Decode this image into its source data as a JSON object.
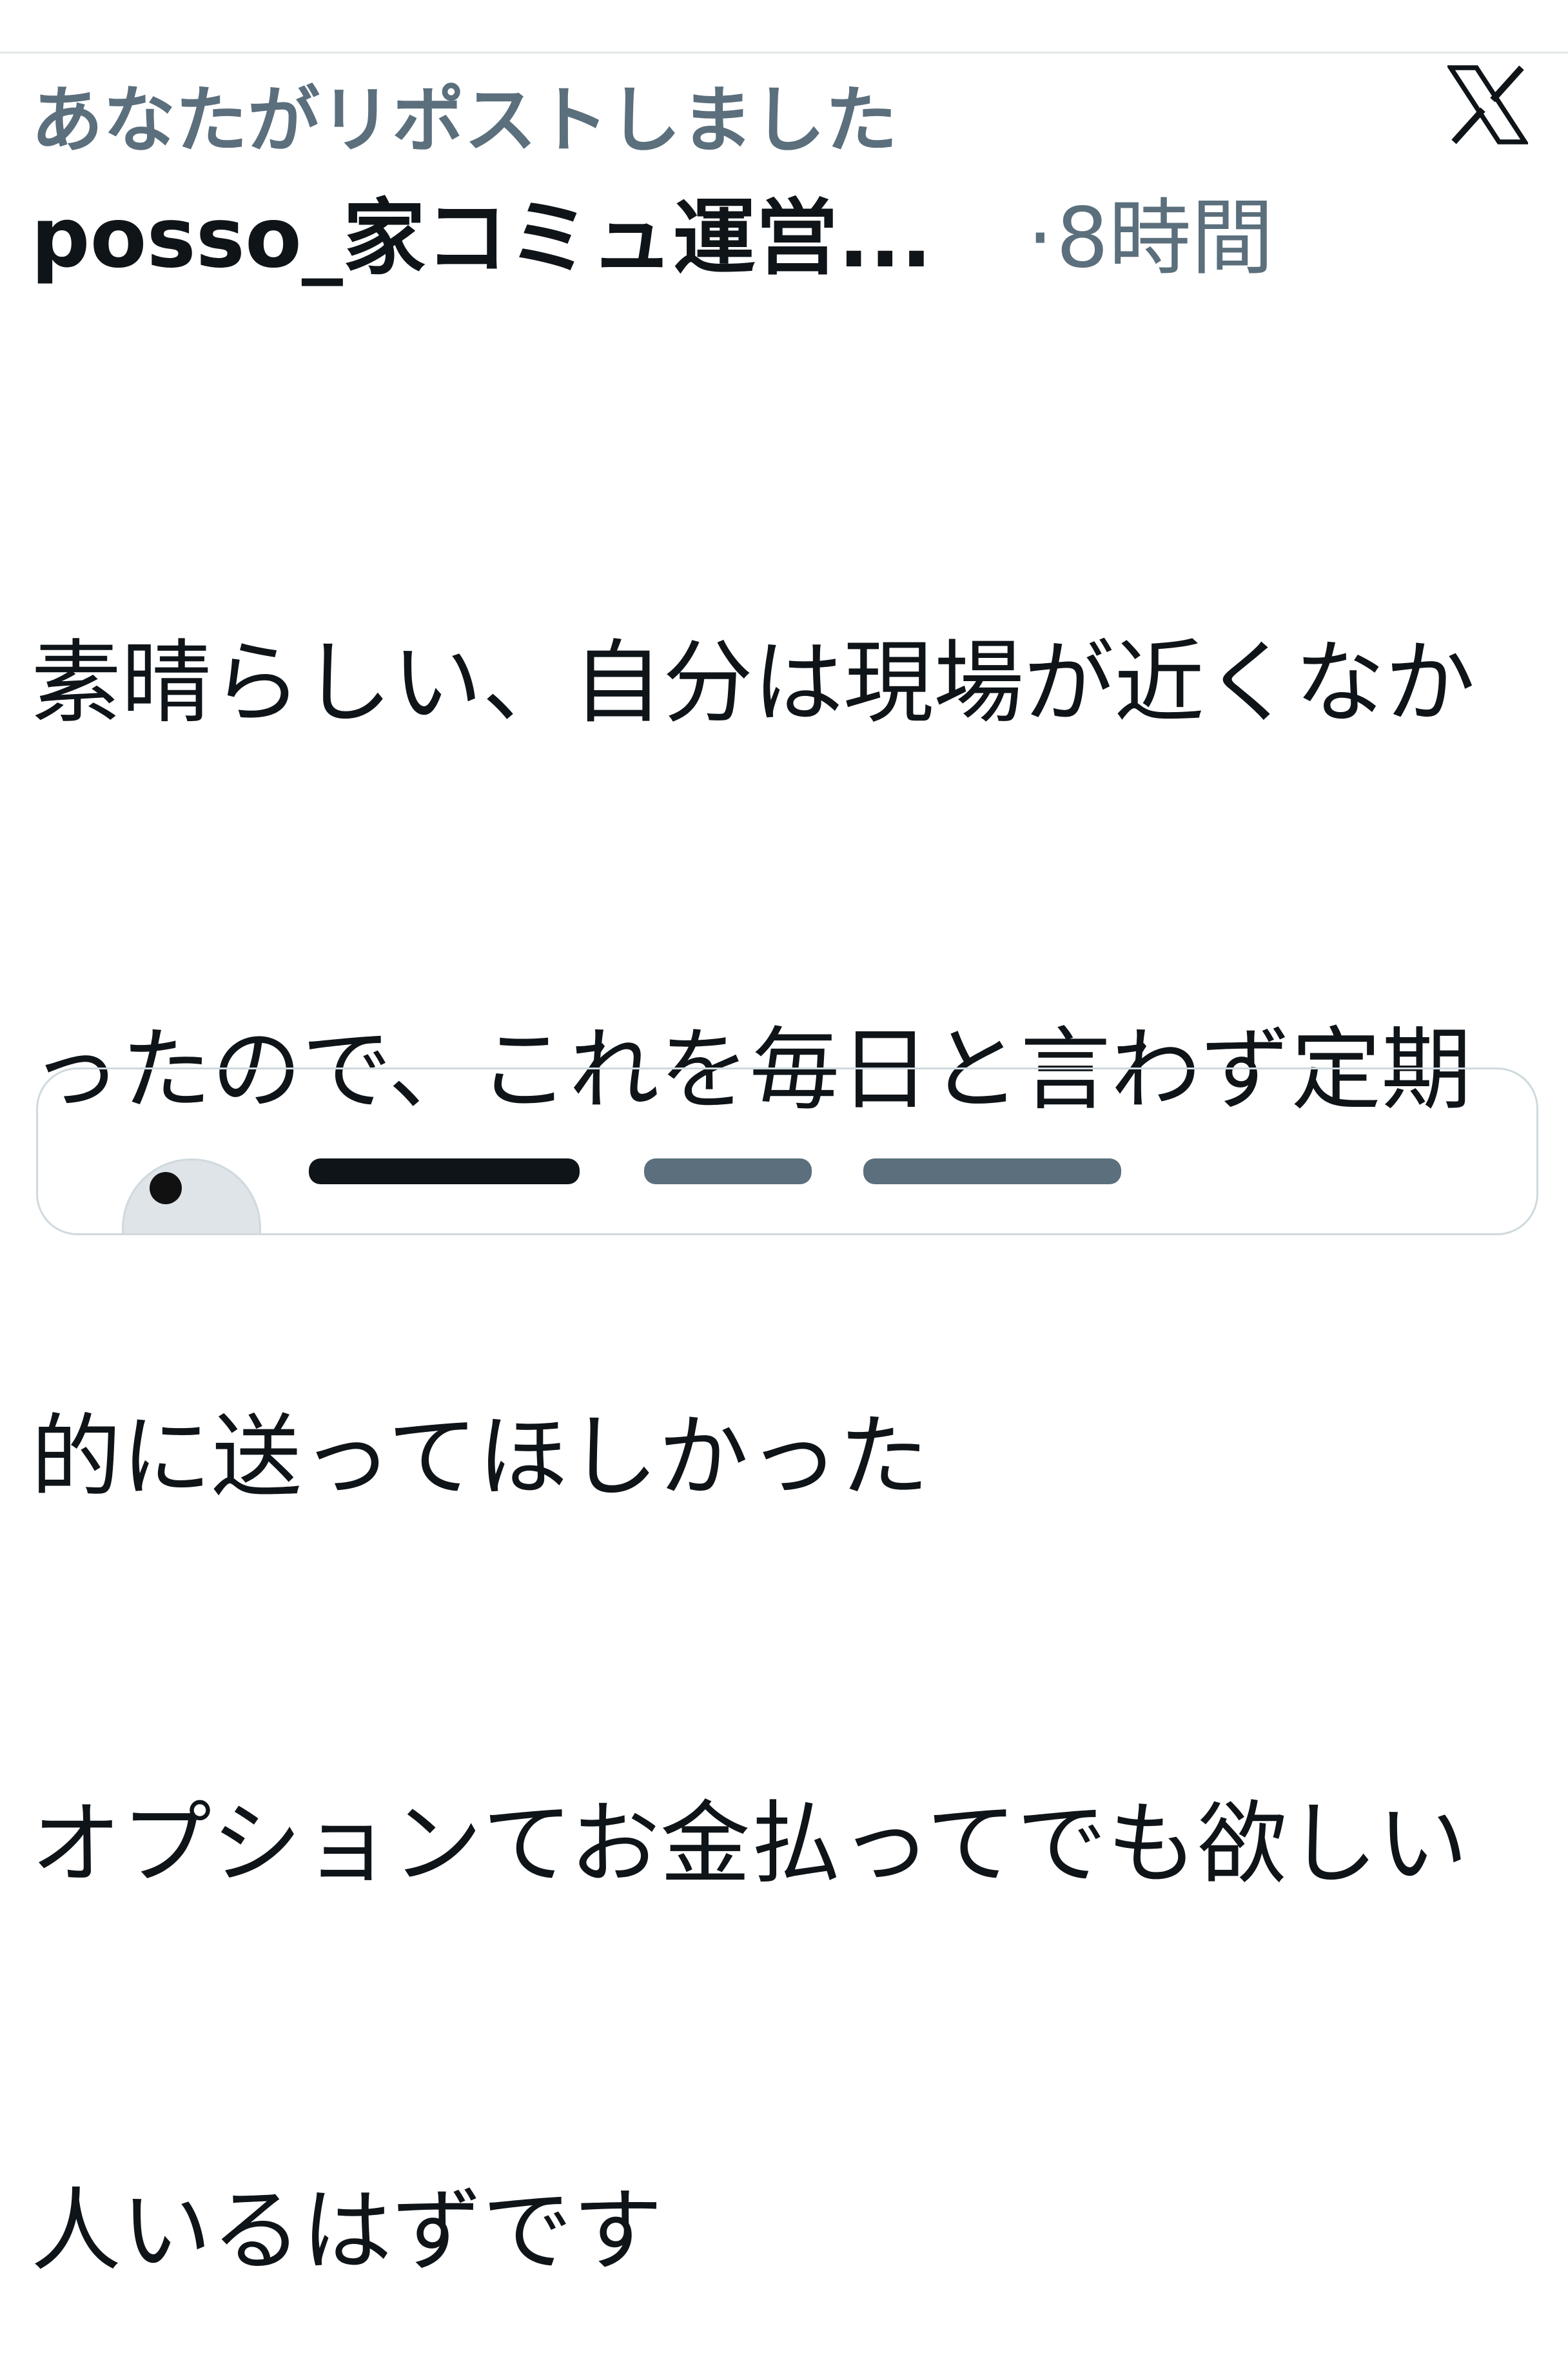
{
  "repost_context": {
    "text": "あなたがリポストしました"
  },
  "post": {
    "author_name": "posso_家コミュ運営...",
    "separator": "·",
    "timestamp": "8時間",
    "source_icon": "x-logo-icon",
    "body_lines": [
      "素晴らしい、自分は現場が近くなか",
      "ったので、これを毎日と言わず定期",
      "的に送ってほしかった",
      "オプションてお金払ってでも欲しい",
      "人いるはずです"
    ]
  },
  "quoted_post": {
    "avatar_icon": "avatar"
  },
  "colors": {
    "primary_text": "#0f1419",
    "secondary_text": "#5b6f7d",
    "border": "#cfd9de",
    "background": "#ffffff"
  }
}
